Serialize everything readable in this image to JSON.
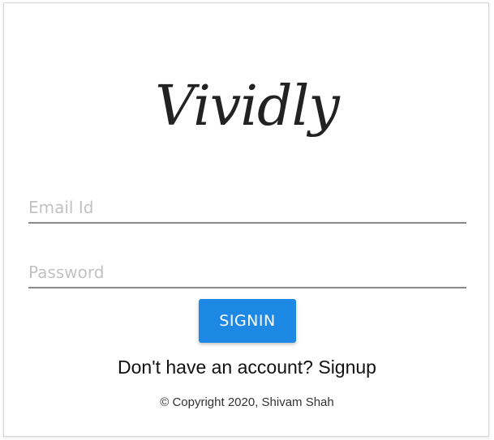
{
  "logo": {
    "text": "Vividly"
  },
  "form": {
    "email_placeholder": "Email Id",
    "email_value": "",
    "password_placeholder": "Password",
    "password_value": ""
  },
  "signin_label": "SIGNIN",
  "signup": {
    "prompt": "Don't have an account?",
    "link_label": "Signup"
  },
  "footer": {
    "copyright": "© Copyright 2020, Shivam Shah"
  },
  "colors": {
    "accent": "#1e88e5",
    "field_underline": "#8a8a8a",
    "placeholder": "#c2c2c2"
  }
}
